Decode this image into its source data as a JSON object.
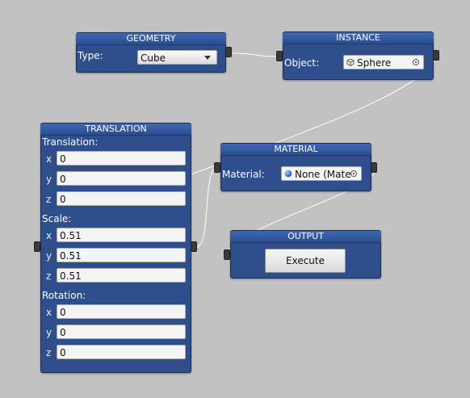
{
  "nodes": {
    "geometry": {
      "title": "GEOMETRY",
      "type_label": "Type:",
      "type_value": "Cube"
    },
    "instance": {
      "title": "INSTANCE",
      "object_label": "Object:",
      "object_value": "Sphere"
    },
    "translation": {
      "title": "TRANSLATION",
      "translation": {
        "label": "Translation:",
        "x": "0",
        "y": "0",
        "z": "0"
      },
      "scale": {
        "label": "Scale:",
        "x": "0.51",
        "y": "0.51",
        "z": "0.51"
      },
      "rotation": {
        "label": "Rotation:",
        "x": "0",
        "y": "0",
        "z": "0"
      },
      "axis": {
        "x": "x",
        "y": "y",
        "z": "z"
      }
    },
    "material": {
      "title": "MATERIAL",
      "material_label": "Material:",
      "material_value": "None (Mate"
    },
    "output": {
      "title": "OUTPUT",
      "execute_label": "Execute"
    }
  },
  "colors": {
    "canvas": "#c2c2c2",
    "node_body": "#2f4f8c",
    "node_header": "#3f68b4",
    "wire": "#ffffff",
    "port": "#3b3b3b"
  }
}
